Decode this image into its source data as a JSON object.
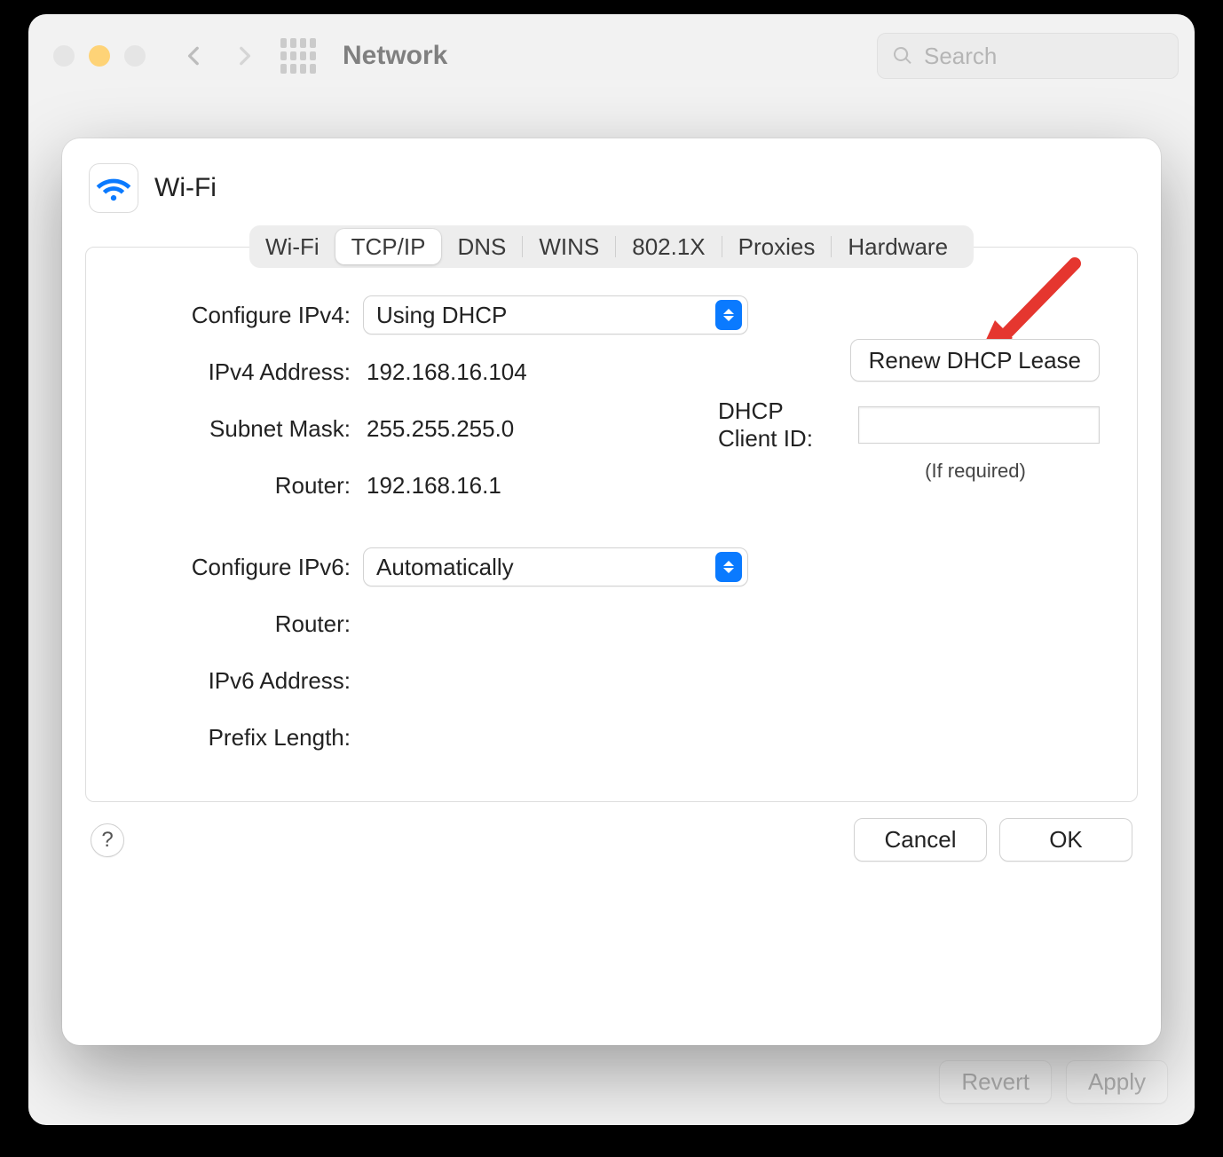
{
  "window": {
    "title": "Network",
    "search_placeholder": "Search",
    "revert_label": "Revert",
    "apply_label": "Apply"
  },
  "sheet": {
    "title": "Wi-Fi",
    "tabs": [
      "Wi-Fi",
      "TCP/IP",
      "DNS",
      "WINS",
      "802.1X",
      "Proxies",
      "Hardware"
    ],
    "active_tab": "TCP/IP",
    "labels": {
      "configure_ipv4": "Configure IPv4:",
      "ipv4_address": "IPv4 Address:",
      "subnet_mask": "Subnet Mask:",
      "router_v4": "Router:",
      "configure_ipv6": "Configure IPv6:",
      "router_v6": "Router:",
      "ipv6_address": "IPv6 Address:",
      "prefix_length": "Prefix Length:",
      "dhcp_client_id": "DHCP Client ID:",
      "if_required": "(If required)"
    },
    "values": {
      "configure_ipv4": "Using DHCP",
      "ipv4_address": "192.168.16.104",
      "subnet_mask": "255.255.255.0",
      "router_v4": "192.168.16.1",
      "configure_ipv6": "Automatically",
      "router_v6": "",
      "ipv6_address": "",
      "prefix_length": "",
      "dhcp_client_id": ""
    },
    "buttons": {
      "renew_dhcp": "Renew DHCP Lease",
      "cancel": "Cancel",
      "ok": "OK",
      "help": "?"
    }
  }
}
